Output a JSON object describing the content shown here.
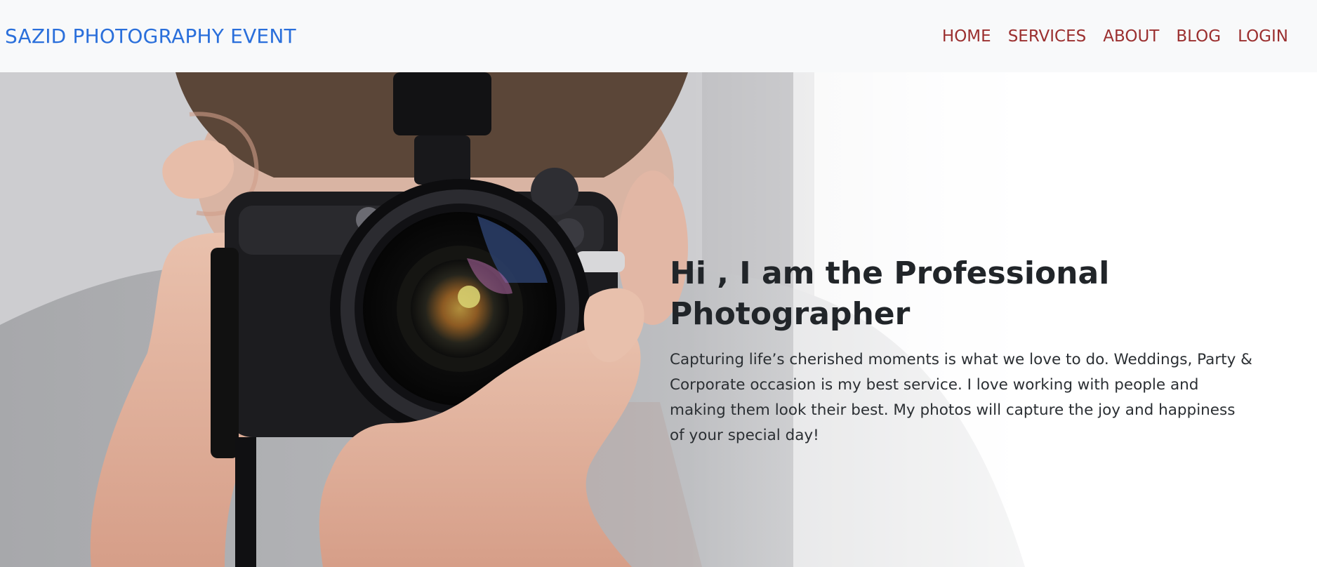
{
  "navbar": {
    "brand": "SAZID PHOTOGRAPHY EVENT",
    "links": [
      "HOME",
      "SERVICES",
      "ABOUT",
      "BLOG",
      "LOGIN"
    ]
  },
  "hero": {
    "title": "Hi , I am the Professional Photographer",
    "description": "Capturing life’s cherished moments is what we love to do. Weddings, Party & Corporate occasion is my best service. I love working with people and making them look their best. My photos will capture the joy and happiness of your special day!",
    "image_icon": "photographer-with-camera-image"
  },
  "colors": {
    "brand": "#2a6fdb",
    "nav_link": "#9b2f2f",
    "navbar_bg": "#f8f9fa",
    "heading": "#212529"
  }
}
